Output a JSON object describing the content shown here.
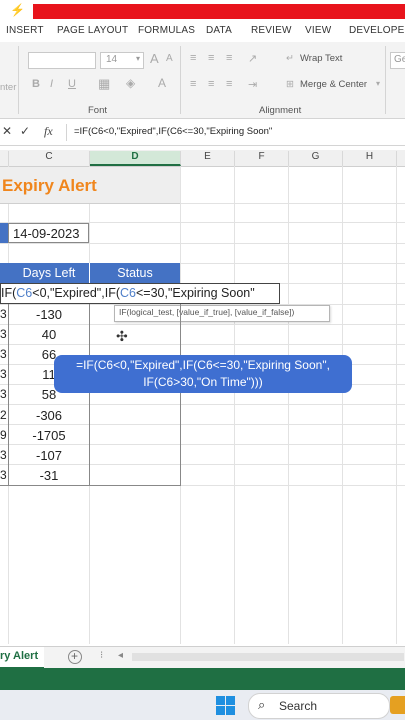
{
  "ribbon": {
    "tabs": [
      "INSERT",
      "PAGE LAYOUT",
      "FORMULAS",
      "DATA",
      "REVIEW",
      "VIEW",
      "DEVELOPER"
    ],
    "font_size": "14",
    "wrap_text": "Wrap Text",
    "merge_center": "Merge & Center",
    "font_group": "Font",
    "alignment_group": "Alignment",
    "cut_label": "nter",
    "ge_label": "Ge",
    "bold": "B",
    "italic": "I",
    "underline": "U",
    "font_grow": "A",
    "font_shrink": "A"
  },
  "formula_bar": {
    "fx": "fx",
    "content": "=IF(C6<0,\"Expired\",IF(C6<=30,\"Expiring Soon\""
  },
  "columns": [
    "C",
    "D",
    "E",
    "F",
    "G",
    "H"
  ],
  "sheet": {
    "title": "Expiry Alert",
    "date": "14-09-2023",
    "header_days": "Days Left",
    "header_status": "Status",
    "edit_prefix": "IF(",
    "edit_ref1": "C6",
    "edit_mid1": "<0,\"Expired\",IF(",
    "edit_ref2": "C6",
    "edit_mid2": "<=30,\"Expiring Soon\"",
    "tooltip": "IF(logical_test, [value_if_true], [value_if_false])",
    "row_labels": [
      "3",
      "3",
      "3",
      "3",
      "3",
      "2",
      "9",
      "3",
      "3"
    ],
    "days_left": [
      "-130",
      "40",
      "66",
      "11",
      "58",
      "-306",
      "-1705",
      "-107",
      "-31"
    ]
  },
  "overlay": {
    "line1": "=IF(C6<0,\"Expired\",IF(C6<=30,\"Expiring Soon\",",
    "line2": "IF(C6>30,\"On Time\")))"
  },
  "sheet_tabs": {
    "active": "ry Alert",
    "add": "+"
  },
  "taskbar": {
    "search": "Search"
  },
  "colors": {
    "accent_orange": "#f0861d",
    "header_blue": "#4472c4",
    "excel_green": "#1f6f43",
    "red_bar": "#e8141c"
  }
}
